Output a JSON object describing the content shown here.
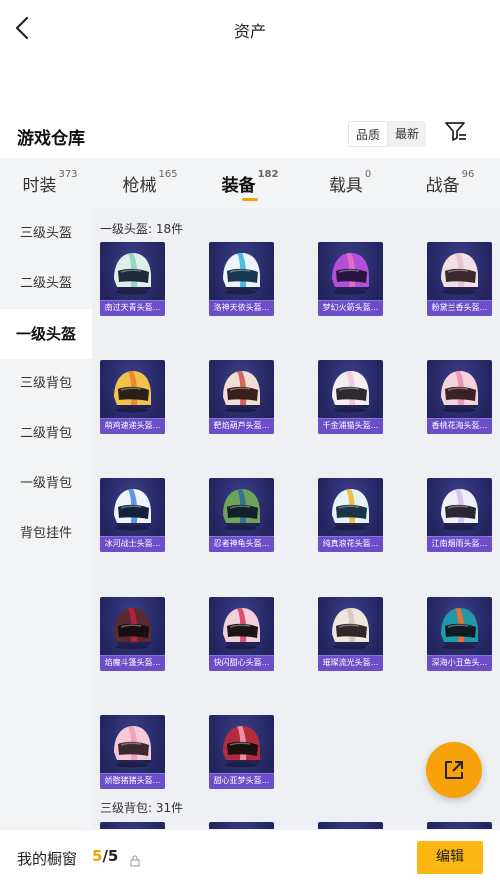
{
  "header": {
    "title": "资产"
  },
  "warehouse": {
    "title": "游戏仓库",
    "sort_quality": "品质",
    "sort_newest": "最新"
  },
  "tabs": [
    {
      "label": "时装",
      "count": "373"
    },
    {
      "label": "枪械",
      "count": "165"
    },
    {
      "label": "装备",
      "count": "182"
    },
    {
      "label": "载具",
      "count": "0"
    },
    {
      "label": "战备",
      "count": "96"
    }
  ],
  "sidebar": {
    "items": [
      "三级头盔",
      "二级头盔",
      "一级头盔",
      "三级背包",
      "二级背包",
      "一级背包",
      "背包挂件"
    ]
  },
  "sections": {
    "helmet1_title": "一级头盔: 18件",
    "backpack3_title": "三级背包: 31件"
  },
  "items": [
    {
      "name": "南过天青头盔...",
      "shell": "#dfeee9",
      "stripe": "#8fd3c2",
      "visor": "#1c2a3a"
    },
    {
      "name": "洛神天依头盔...",
      "shell": "#e9f5fb",
      "stripe": "#35b7e6",
      "visor": "#1a3650"
    },
    {
      "name": "梦幻火箭头盔...",
      "shell": "#b34fd8",
      "stripe": "#e46fc9",
      "visor": "#2a1540"
    },
    {
      "name": "粉黛兰香头盔...",
      "shell": "#f1dfe4",
      "stripe": "#e9c2cd",
      "visor": "#3a2a30"
    },
    {
      "name": "萌鸡速递头盔...",
      "shell": "#f3c24c",
      "stripe": "#e8862e",
      "visor": "#2a2018"
    },
    {
      "name": "靶焰葫芦头盔...",
      "shell": "#f2ddd5",
      "stripe": "#cf5b4b",
      "visor": "#3a1e1a"
    },
    {
      "name": "千金浦猫头盔...",
      "shell": "#f5eef0",
      "stripe": "#f0c9d4",
      "visor": "#2e2a30"
    },
    {
      "name": "香桃花海头盔...",
      "shell": "#f6d3dc",
      "stripe": "#ea94ab",
      "visor": "#3a2128"
    },
    {
      "name": "冰河战士头盔...",
      "shell": "#eef4fa",
      "stripe": "#4a8fd8",
      "visor": "#13223a"
    },
    {
      "name": "忍者神龟头盔...",
      "shell": "#6fa35a",
      "stripe": "#2f6e9c",
      "visor": "#12202a"
    },
    {
      "name": "纯真浪花头盔...",
      "shell": "#e6f3f6",
      "stripe": "#f0b83a",
      "visor": "#1c3446"
    },
    {
      "name": "江南烟雨头盔...",
      "shell": "#f0eef6",
      "stripe": "#d4c3e8",
      "visor": "#2a2636"
    },
    {
      "name": "焰魔斗篷头盔...",
      "shell": "#5a2a34",
      "stripe": "#c41e3a",
      "visor": "#1a0c10"
    },
    {
      "name": "快闪甜心头盔...",
      "shell": "#f2cfdb",
      "stripe": "#d7436a",
      "visor": "#1c1418"
    },
    {
      "name": "璀璨流光头盔...",
      "shell": "#efe6de",
      "stripe": "#d9c7b8",
      "visor": "#302828"
    },
    {
      "name": "深海小丑鱼头...",
      "shell": "#1f9aa8",
      "stripe": "#f36b2b",
      "visor": "#0c1c22"
    },
    {
      "name": "娇憨猪猪头盔...",
      "shell": "#f7c9d6",
      "stripe": "#f09bb1",
      "visor": "#3a2a30"
    },
    {
      "name": "甜心亚梦头盔...",
      "shell": "#b52c3c",
      "stripe": "#f09aa9",
      "visor": "#1c1012"
    }
  ],
  "bottom": {
    "my_window": "我的橱窗",
    "current": "5",
    "total": "/5",
    "edit_label": "编辑"
  },
  "colors": {
    "accent": "#f5a500",
    "card_bg": "#22255e",
    "card_bar": "#6c4fc8"
  }
}
